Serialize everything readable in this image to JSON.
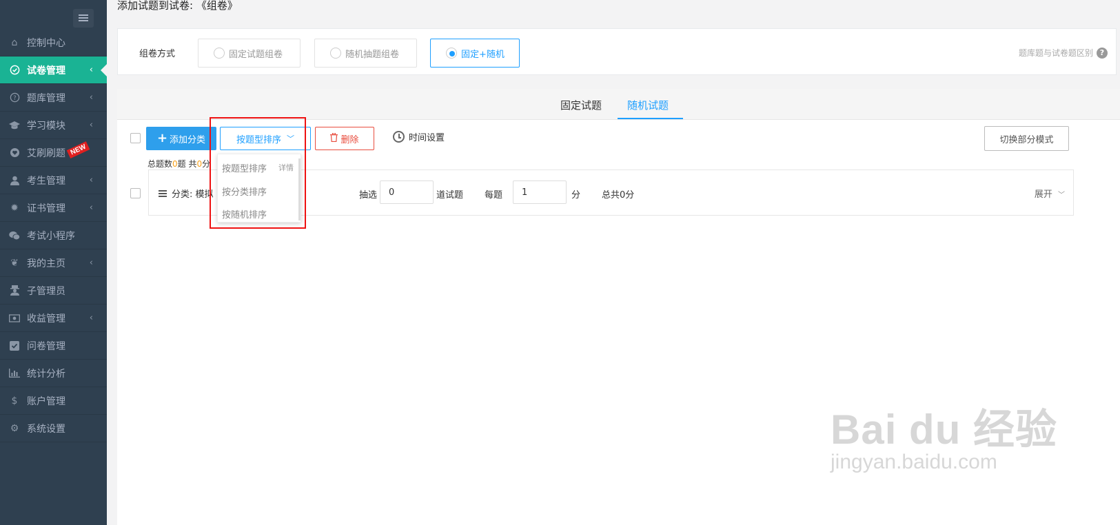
{
  "page_title": "添加试题到试卷: 《组卷》",
  "sidebar": {
    "items": [
      {
        "label": "控制中心",
        "icon": "home-icon",
        "has_chevron": false
      },
      {
        "label": "试卷管理",
        "icon": "check-circle-icon",
        "has_chevron": true,
        "active": true
      },
      {
        "label": "题库管理",
        "icon": "question-circle-icon",
        "has_chevron": true
      },
      {
        "label": "学习模块",
        "icon": "graduation-cap-icon",
        "has_chevron": true
      },
      {
        "label": "艾刷刷题",
        "icon": "heart-icon",
        "has_chevron": false,
        "badge": "NEW"
      },
      {
        "label": "考生管理",
        "icon": "user-icon",
        "has_chevron": true
      },
      {
        "label": "证书管理",
        "icon": "certificate-icon",
        "has_chevron": true
      },
      {
        "label": "考试小程序",
        "icon": "wechat-icon",
        "has_chevron": false
      },
      {
        "label": "我的主页",
        "icon": "pagelines-icon",
        "has_chevron": true
      },
      {
        "label": "子管理员",
        "icon": "user-secret-icon",
        "has_chevron": false
      },
      {
        "label": "收益管理",
        "icon": "money-icon",
        "has_chevron": true
      },
      {
        "label": "问卷管理",
        "icon": "check-square-icon",
        "has_chevron": false
      },
      {
        "label": "统计分析",
        "icon": "bar-chart-icon",
        "has_chevron": false
      },
      {
        "label": "账户管理",
        "icon": "dollar-icon",
        "has_chevron": false
      },
      {
        "label": "系统设置",
        "icon": "gear-icon",
        "has_chevron": false
      }
    ]
  },
  "mode": {
    "label": "组卷方式",
    "options": [
      "固定试题组卷",
      "随机抽题组卷",
      "固定+随机"
    ],
    "selected": "固定+随机",
    "diff_link": "题库题与试卷题区别"
  },
  "tabs": [
    "固定试题",
    "随机试题"
  ],
  "active_tab": "随机试题",
  "toolbar": {
    "add_category": "添加分类",
    "sort_label": "按题型排序",
    "delete": "删除",
    "time_settings": "时间设置",
    "switch_mode": "切换部分模式"
  },
  "summary": {
    "prefix": "总题数",
    "count": "0",
    "mid": "题 共",
    "score": "0",
    "suffix": "分"
  },
  "category_row": {
    "label": "分类: 模拟",
    "pick_label": "抽选",
    "pick_value": "0",
    "questions_label": "道试题",
    "per_label": "每题",
    "per_value": "1",
    "score_unit": "分",
    "total": "总共0分",
    "expand": "展开"
  },
  "sort_dropdown": {
    "options": [
      "按题型排序",
      "按分类排序",
      "按随机排序"
    ],
    "detail": "详情"
  },
  "watermark": {
    "main": "Bai du 经验",
    "sub": "jingyan.baidu.com"
  },
  "colors": {
    "sidebar_bg": "#2f4050",
    "active_green": "#1ab394",
    "primary_blue": "#1e9fff",
    "danger_red": "#e84c3d",
    "highlight_red": "#ee1111"
  }
}
